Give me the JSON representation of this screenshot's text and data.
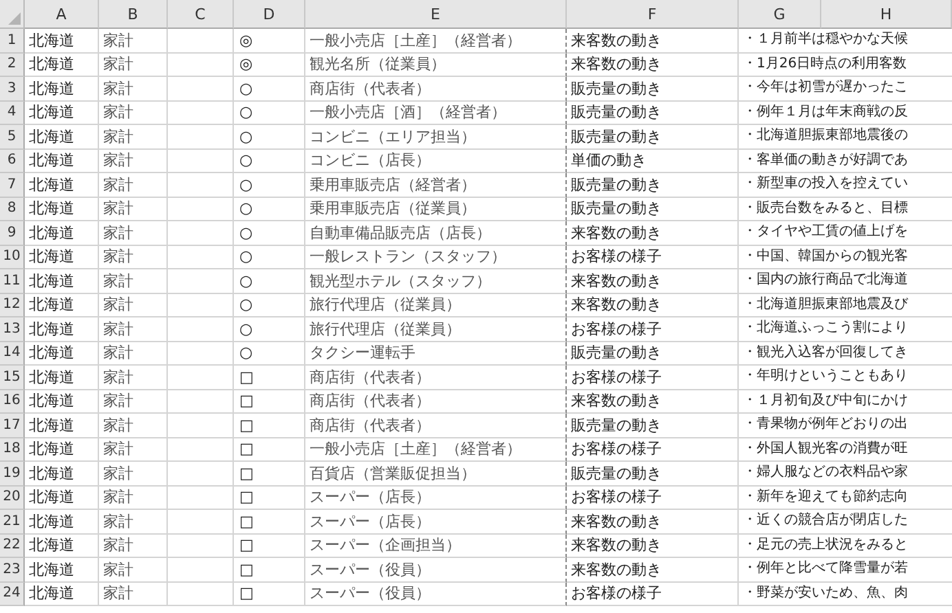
{
  "columns": [
    "A",
    "B",
    "C",
    "D",
    "E",
    "F",
    "G",
    "H"
  ],
  "rows": [
    {
      "number": "1",
      "col_a": "北海道",
      "col_b": "家計",
      "col_d": "◎",
      "col_e": "一般小売店［土産］（経営者）",
      "col_f": "来客数の動き",
      "col_g": "・１月前半は穏やかな天候"
    },
    {
      "number": "2",
      "col_a": "北海道",
      "col_b": "家計",
      "col_d": "◎",
      "col_e": "観光名所（従業員）",
      "col_f": "来客数の動き",
      "col_g": "・1月26日時点の利用客数"
    },
    {
      "number": "3",
      "col_a": "北海道",
      "col_b": "家計",
      "col_d": "○",
      "col_e": "商店街（代表者）",
      "col_f": "販売量の動き",
      "col_g": "・今年は初雪が遅かったこ"
    },
    {
      "number": "4",
      "col_a": "北海道",
      "col_b": "家計",
      "col_d": "○",
      "col_e": "一般小売店［酒］（経営者）",
      "col_f": "販売量の動き",
      "col_g": "・例年１月は年末商戦の反"
    },
    {
      "number": "5",
      "col_a": "北海道",
      "col_b": "家計",
      "col_d": "○",
      "col_e": "コンビニ（エリア担当）",
      "col_f": "販売量の動き",
      "col_g": "・北海道胆振東部地震後の"
    },
    {
      "number": "6",
      "col_a": "北海道",
      "col_b": "家計",
      "col_d": "○",
      "col_e": "コンビニ（店長）",
      "col_f": "単価の動き",
      "col_g": "・客単価の動きが好調であ"
    },
    {
      "number": "7",
      "col_a": "北海道",
      "col_b": "家計",
      "col_d": "○",
      "col_e": "乗用車販売店（経営者）",
      "col_f": "販売量の動き",
      "col_g": "・新型車の投入を控えてい"
    },
    {
      "number": "8",
      "col_a": "北海道",
      "col_b": "家計",
      "col_d": "○",
      "col_e": "乗用車販売店（従業員）",
      "col_f": "販売量の動き",
      "col_g": "・販売台数をみると、目標"
    },
    {
      "number": "9",
      "col_a": "北海道",
      "col_b": "家計",
      "col_d": "○",
      "col_e": "自動車備品販売店（店長）",
      "col_f": "来客数の動き",
      "col_g": "・タイヤや工賃の値上げを"
    },
    {
      "number": "10",
      "col_a": "北海道",
      "col_b": "家計",
      "col_d": "○",
      "col_e": "一般レストラン（スタッフ）",
      "col_f": "お客様の様子",
      "col_g": "・中国、韓国からの観光客"
    },
    {
      "number": "11",
      "col_a": "北海道",
      "col_b": "家計",
      "col_d": "○",
      "col_e": "観光型ホテル（スタッフ）",
      "col_f": "来客数の動き",
      "col_g": "・国内の旅行商品で北海道"
    },
    {
      "number": "12",
      "col_a": "北海道",
      "col_b": "家計",
      "col_d": "○",
      "col_e": "旅行代理店（従業員）",
      "col_f": "来客数の動き",
      "col_g": "・北海道胆振東部地震及び"
    },
    {
      "number": "13",
      "col_a": "北海道",
      "col_b": "家計",
      "col_d": "○",
      "col_e": "旅行代理店（従業員）",
      "col_f": "お客様の様子",
      "col_g": "・北海道ふっこう割により"
    },
    {
      "number": "14",
      "col_a": "北海道",
      "col_b": "家計",
      "col_d": "○",
      "col_e": "タクシー運転手",
      "col_f": "販売量の動き",
      "col_g": "・観光入込客が回復してき"
    },
    {
      "number": "15",
      "col_a": "北海道",
      "col_b": "家計",
      "col_d": "□",
      "col_e": "商店街（代表者）",
      "col_f": "お客様の様子",
      "col_g": "・年明けということもあり"
    },
    {
      "number": "16",
      "col_a": "北海道",
      "col_b": "家計",
      "col_d": "□",
      "col_e": "商店街（代表者）",
      "col_f": "来客数の動き",
      "col_g": "・１月初旬及び中旬にかけ"
    },
    {
      "number": "17",
      "col_a": "北海道",
      "col_b": "家計",
      "col_d": "□",
      "col_e": "商店街（代表者）",
      "col_f": "販売量の動き",
      "col_g": "・青果物が例年どおりの出"
    },
    {
      "number": "18",
      "col_a": "北海道",
      "col_b": "家計",
      "col_d": "□",
      "col_e": "一般小売店［土産］（経営者）",
      "col_f": "お客様の様子",
      "col_g": "・外国人観光客の消費が旺"
    },
    {
      "number": "19",
      "col_a": "北海道",
      "col_b": "家計",
      "col_d": "□",
      "col_e": "百貨店（営業販促担当）",
      "col_f": "販売量の動き",
      "col_g": "・婦人服などの衣料品や家"
    },
    {
      "number": "20",
      "col_a": "北海道",
      "col_b": "家計",
      "col_d": "□",
      "col_e": "スーパー（店長）",
      "col_f": "お客様の様子",
      "col_g": "・新年を迎えても節約志向"
    },
    {
      "number": "21",
      "col_a": "北海道",
      "col_b": "家計",
      "col_d": "□",
      "col_e": "スーパー（店長）",
      "col_f": "来客数の動き",
      "col_g": "・近くの競合店が閉店した"
    },
    {
      "number": "22",
      "col_a": "北海道",
      "col_b": "家計",
      "col_d": "□",
      "col_e": "スーパー（企画担当）",
      "col_f": "来客数の動き",
      "col_g": "・足元の売上状況をみると"
    },
    {
      "number": "23",
      "col_a": "北海道",
      "col_b": "家計",
      "col_d": "□",
      "col_e": "スーパー（役員）",
      "col_f": "来客数の動き",
      "col_g": "・例年と比べて降雪量が若"
    },
    {
      "number": "24",
      "col_a": "北海道",
      "col_b": "家計",
      "col_d": "□",
      "col_e": "スーパー（役員）",
      "col_f": "お客様の様子",
      "col_g": "・野菜が安いため、魚、肉"
    }
  ]
}
